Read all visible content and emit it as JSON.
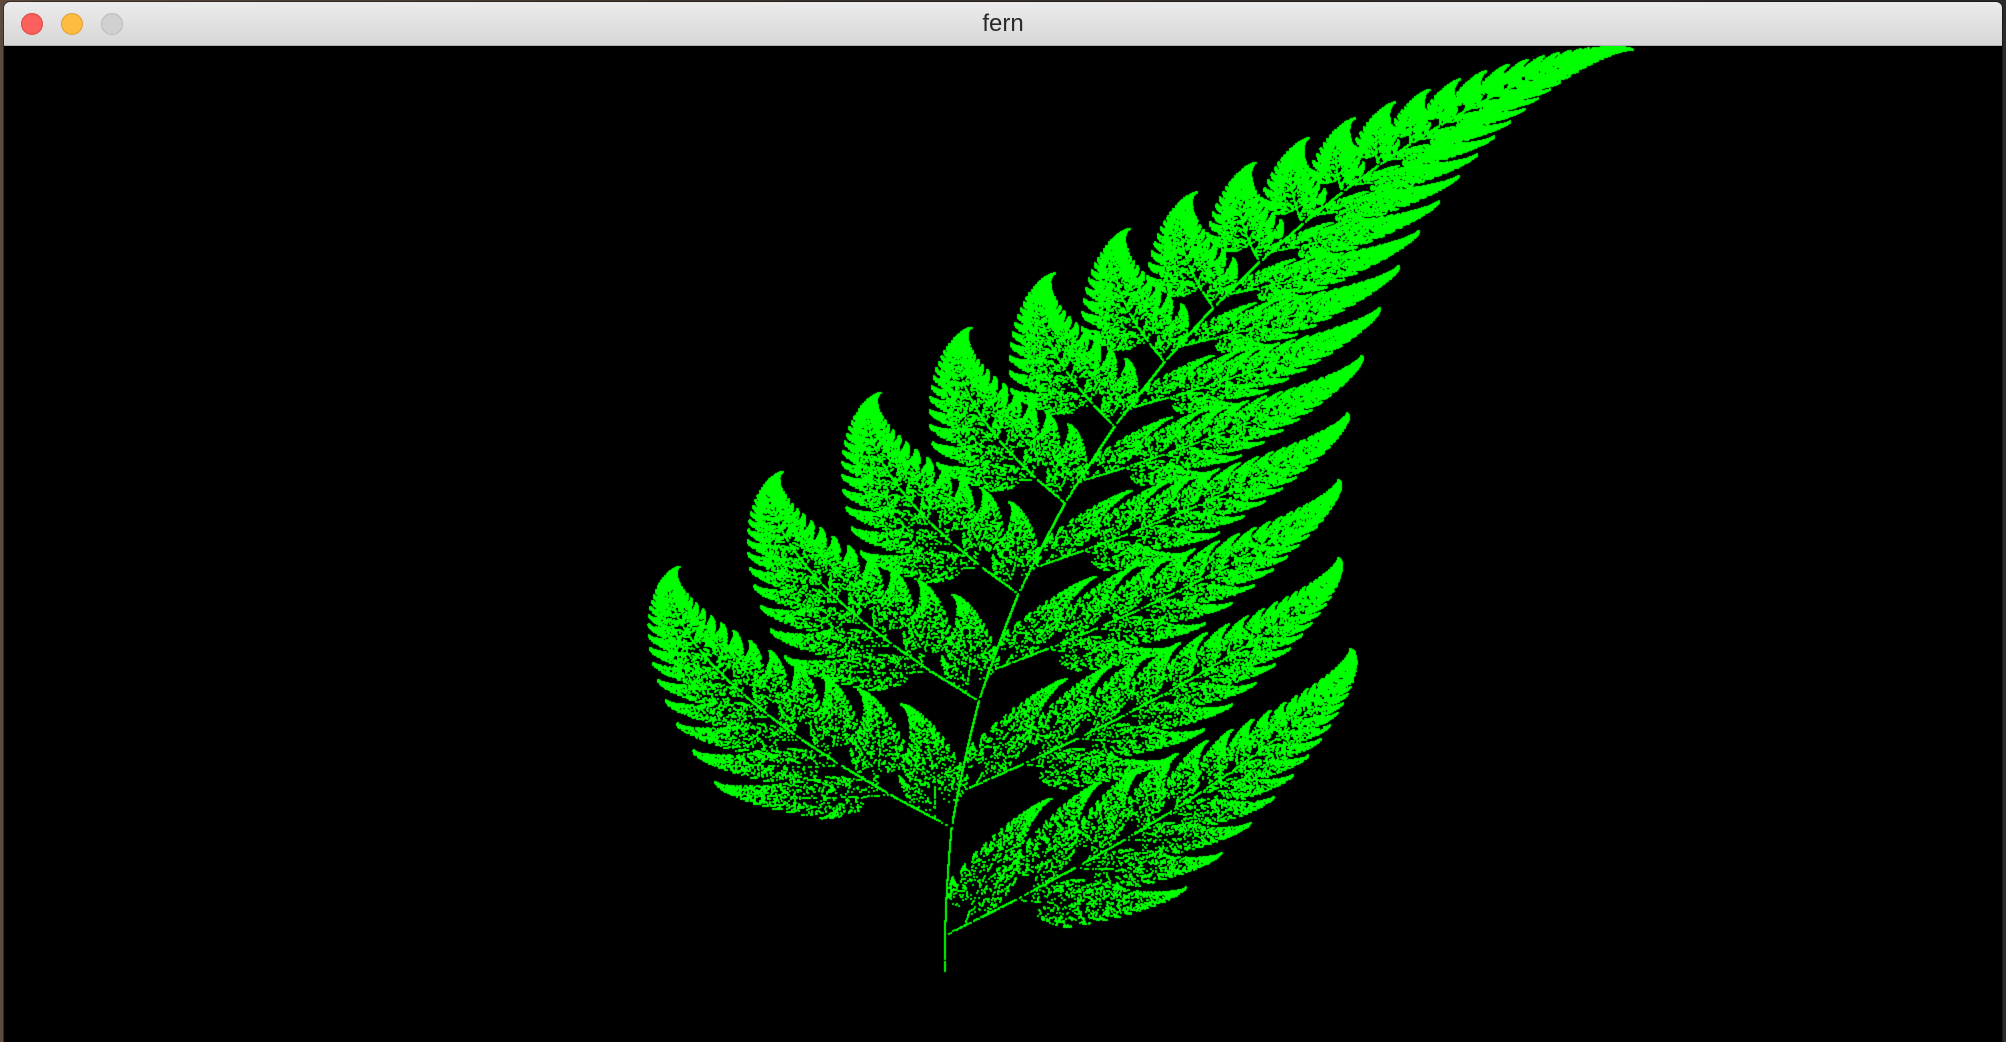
{
  "window": {
    "title": "fern"
  },
  "controls": {
    "close": "close-icon",
    "minimize": "minimize-icon",
    "zoom": "zoom-icon"
  },
  "colors": {
    "fern": "#00ff00",
    "background": "#000000",
    "close": "#fc605c",
    "minimize": "#fdbc40",
    "zoom": "#d0d0d0"
  }
}
